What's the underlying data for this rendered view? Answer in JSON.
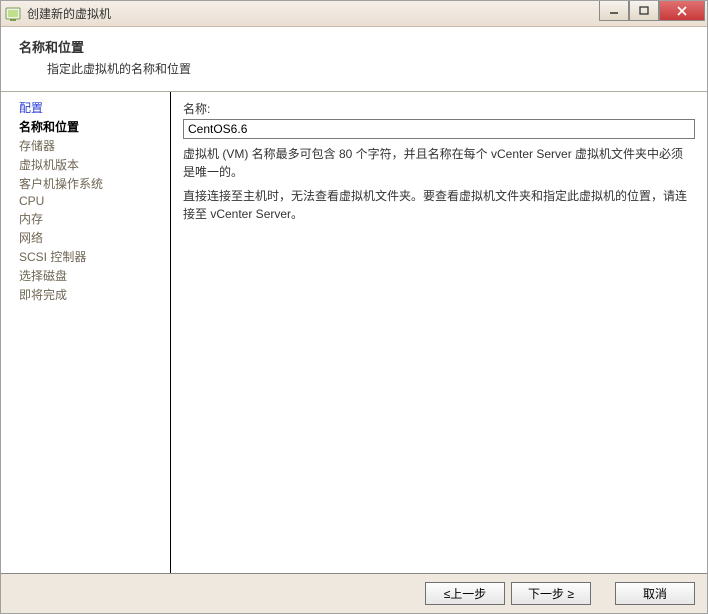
{
  "window": {
    "title": "创建新的虚拟机"
  },
  "header": {
    "title": "名称和位置",
    "subtitle": "指定此虚拟机的名称和位置"
  },
  "sidebar": {
    "items": [
      {
        "label": "配置",
        "link": true
      },
      {
        "label": "名称和位置",
        "current": true
      },
      {
        "label": "存储器"
      },
      {
        "label": "虚拟机版本"
      },
      {
        "label": "客户机操作系统"
      },
      {
        "label": "CPU"
      },
      {
        "label": "内存"
      },
      {
        "label": "网络"
      },
      {
        "label": "SCSI 控制器"
      },
      {
        "label": "选择磁盘"
      },
      {
        "label": "即将完成"
      }
    ]
  },
  "main": {
    "name_label": "名称:",
    "name_value": "CentOS6.6",
    "help1": "虚拟机 (VM) 名称最多可包含 80 个字符，并且名称在每个 vCenter Server 虚拟机文件夹中必须是唯一的。",
    "help2": "直接连接至主机时，无法查看虚拟机文件夹。要查看虚拟机文件夹和指定此虚拟机的位置，请连接至 vCenter Server。"
  },
  "footer": {
    "back": "≤上一步",
    "next": "下一步 ≥",
    "cancel": "取消"
  }
}
